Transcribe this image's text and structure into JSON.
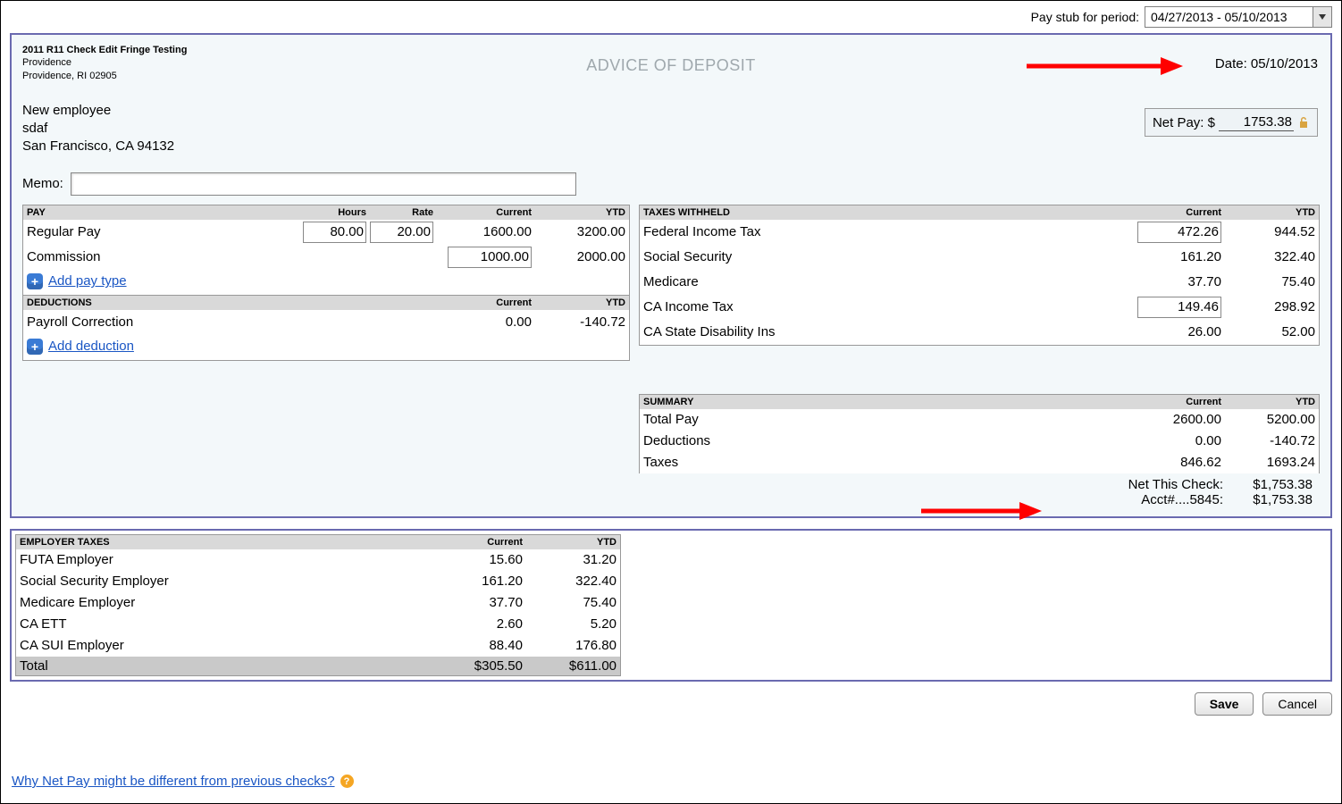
{
  "topbar": {
    "label": "Pay stub for period:",
    "value": "04/27/2013 - 05/10/2013"
  },
  "check": {
    "org": {
      "line1": "2011 R11 Check Edit Fringe Testing",
      "line2": "Providence",
      "line3": "Providence, RI 02905"
    },
    "advice": "ADVICE OF DEPOSIT",
    "date_label": "Date:",
    "date": "05/10/2013",
    "employee": {
      "line1": "New employee",
      "line2": "sdaf",
      "line3": "San Francisco, CA 94132"
    },
    "netpay": {
      "label": "Net Pay: $",
      "value": "1753.38"
    },
    "memo_label": "Memo:",
    "memo_value": ""
  },
  "pay": {
    "title": "PAY",
    "cols": {
      "hours": "Hours",
      "rate": "Rate",
      "current": "Current",
      "ytd": "YTD"
    },
    "rows": [
      {
        "name": "Regular Pay",
        "hours": "80.00",
        "rate": "20.00",
        "current": "1600.00",
        "ytd": "3200.00"
      },
      {
        "name": "Commission",
        "hours": "",
        "rate": "",
        "current": "1000.00",
        "ytd": "2000.00"
      }
    ],
    "add_label": "Add pay type"
  },
  "ded": {
    "title": "DEDUCTIONS",
    "cols": {
      "current": "Current",
      "ytd": "YTD"
    },
    "rows": [
      {
        "name": "Payroll Correction",
        "current": "0.00",
        "ytd": "-140.72"
      }
    ],
    "add_label": "Add deduction"
  },
  "tax": {
    "title": "TAXES WITHHELD",
    "cols": {
      "current": "Current",
      "ytd": "YTD"
    },
    "rows": [
      {
        "name": "Federal Income Tax",
        "current": "472.26",
        "ytd": "944.52",
        "editable": true
      },
      {
        "name": "Social Security",
        "current": "161.20",
        "ytd": "322.40",
        "editable": false
      },
      {
        "name": "Medicare",
        "current": "37.70",
        "ytd": "75.40",
        "editable": false
      },
      {
        "name": "CA Income Tax",
        "current": "149.46",
        "ytd": "298.92",
        "editable": true
      },
      {
        "name": "CA State Disability Ins",
        "current": "26.00",
        "ytd": "52.00",
        "editable": false
      }
    ]
  },
  "summary": {
    "title": "SUMMARY",
    "cols": {
      "current": "Current",
      "ytd": "YTD"
    },
    "rows": [
      {
        "name": "Total Pay",
        "current": "2600.00",
        "ytd": "5200.00"
      },
      {
        "name": "Deductions",
        "current": "0.00",
        "ytd": "-140.72"
      },
      {
        "name": "Taxes",
        "current": "846.62",
        "ytd": "1693.24"
      }
    ],
    "netcheck": {
      "label": "Net This Check:",
      "value": "$1,753.38"
    },
    "acct": {
      "label": "Acct#....5845:",
      "value": "$1,753.38"
    }
  },
  "emptax": {
    "title": "EMPLOYER TAXES",
    "cols": {
      "current": "Current",
      "ytd": "YTD"
    },
    "rows": [
      {
        "name": "FUTA Employer",
        "current": "15.60",
        "ytd": "31.20"
      },
      {
        "name": "Social Security Employer",
        "current": "161.20",
        "ytd": "322.40"
      },
      {
        "name": "Medicare Employer",
        "current": "37.70",
        "ytd": "75.40"
      },
      {
        "name": "CA ETT",
        "current": "2.60",
        "ytd": "5.20"
      },
      {
        "name": "CA SUI Employer",
        "current": "88.40",
        "ytd": "176.80"
      }
    ],
    "total": {
      "label": "Total",
      "current": "$305.50",
      "ytd": "$611.00"
    }
  },
  "buttons": {
    "save": "Save",
    "cancel": "Cancel"
  },
  "footer_link": "Why Net Pay might be different from previous checks?"
}
